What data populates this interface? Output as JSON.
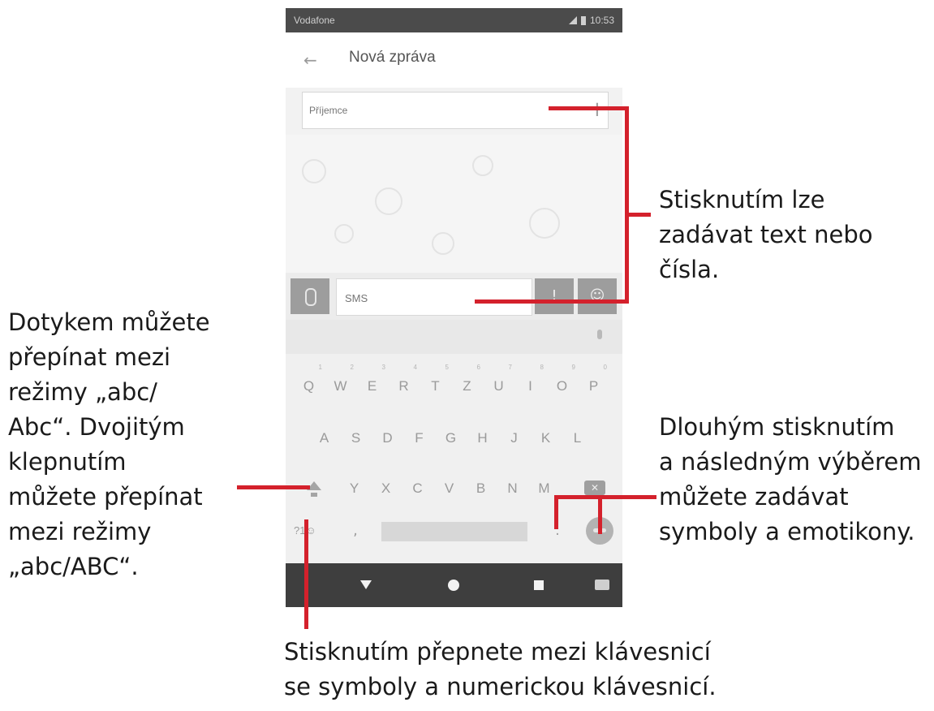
{
  "status_bar": {
    "carrier": "Vodafone",
    "time": "10:53"
  },
  "app_bar": {
    "title": "Nová zpráva",
    "back_icon": "arrow-back-icon"
  },
  "recipient": {
    "placeholder": "Příjemce",
    "add_icon": "plus-icon"
  },
  "compose": {
    "placeholder": "SMS",
    "attach_icon": "paperclip-icon",
    "emoji_icon": "emoji-icon",
    "button1_glyph": "!",
    "button2_glyph": "☺"
  },
  "keyboard": {
    "row1": [
      {
        "key": "Q",
        "hint": "1"
      },
      {
        "key": "W",
        "hint": "2"
      },
      {
        "key": "E",
        "hint": "3"
      },
      {
        "key": "R",
        "hint": "4"
      },
      {
        "key": "T",
        "hint": "5"
      },
      {
        "key": "Z",
        "hint": "6"
      },
      {
        "key": "U",
        "hint": "7"
      },
      {
        "key": "I",
        "hint": "8"
      },
      {
        "key": "O",
        "hint": "9"
      },
      {
        "key": "P",
        "hint": "0"
      }
    ],
    "row2": [
      "A",
      "S",
      "D",
      "F",
      "G",
      "H",
      "J",
      "K",
      "L"
    ],
    "row3": [
      "Y",
      "X",
      "C",
      "V",
      "B",
      "N",
      "M"
    ],
    "symbols_key": "?1☺",
    "comma": ",",
    "period": "."
  },
  "callouts": {
    "top_right": "Stisknutím lze\nzadávat text nebo\nčísla.",
    "left": "Dotykem můžete\npřepínat mezi\nrežimy „abc/\nAbc“. Dvojitým\nklepnutím\nmůžete přepínat\nmezi režimy\n„abc/ABC“.",
    "right": "Dlouhým stisknutím\na následným výběrem\nmůžete zadávat\nsymboly a emotikony.",
    "bottom": "Stisknutím přepnete mezi klávesnicí\nse symboly a numerickou klávesnicí."
  },
  "accent_color": "#d4212c"
}
